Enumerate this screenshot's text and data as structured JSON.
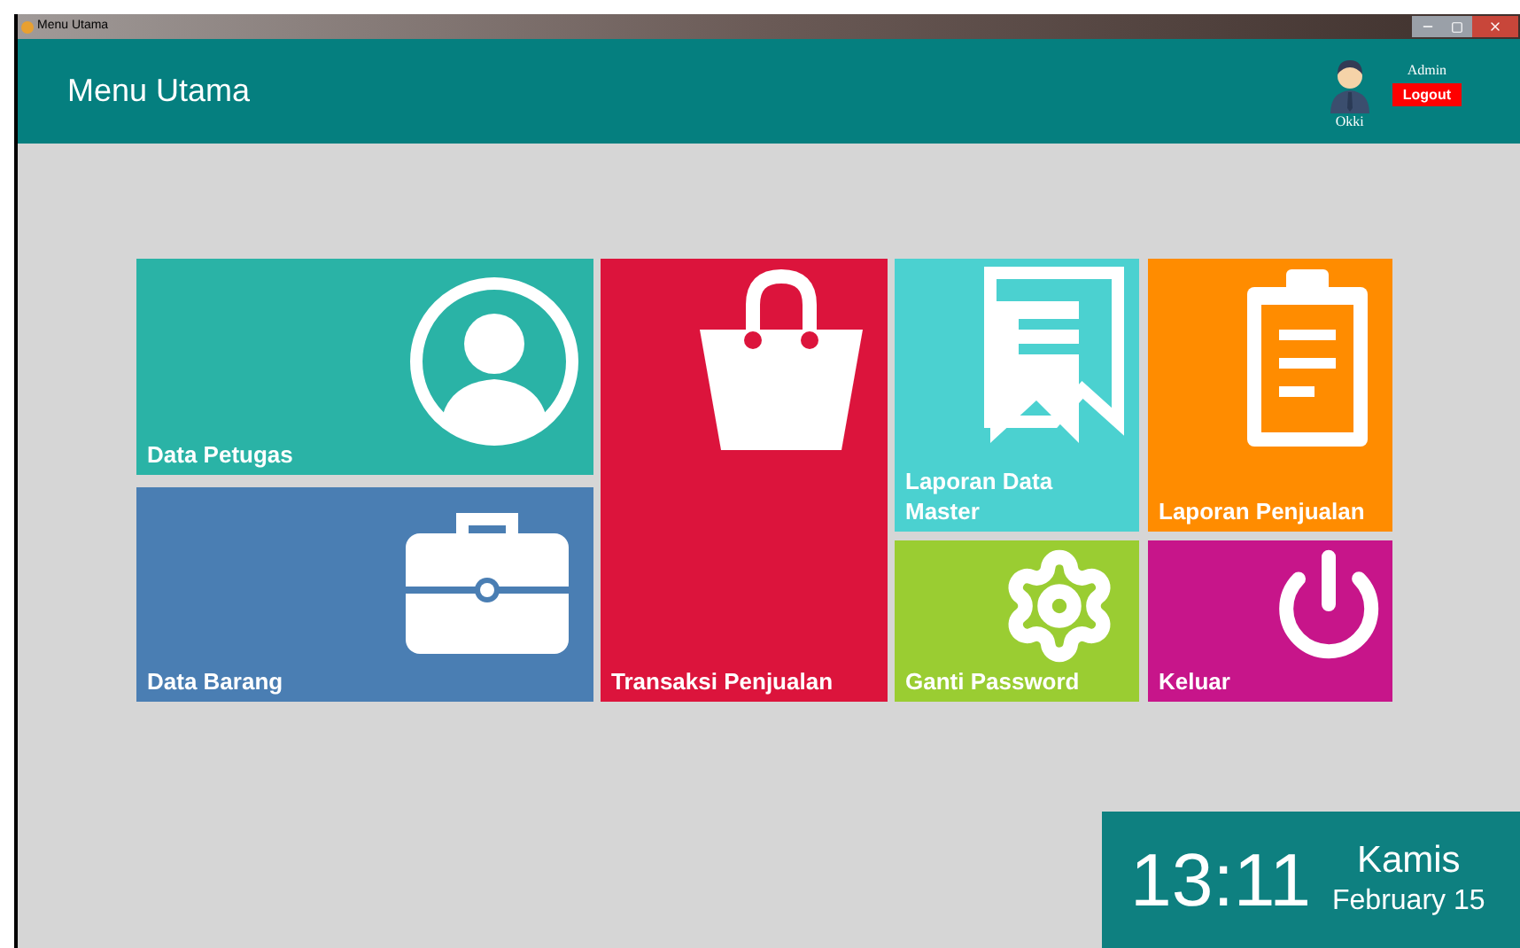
{
  "window": {
    "title": "Menu Utama"
  },
  "header": {
    "title": "Menu Utama",
    "user_name": "Okki",
    "role": "Admin",
    "logout": "Logout"
  },
  "tiles": [
    {
      "label": "Data Petugas",
      "kind": "person",
      "color": "#2ab3a6"
    },
    {
      "label": "Data Barang",
      "kind": "briefcase",
      "color": "#4a7eb3"
    },
    {
      "label": "Transaksi Penjualan",
      "kind": "bag",
      "color": "#dc143c"
    },
    {
      "label": "Laporan Data Master",
      "kind": "document",
      "color": "#4bd1d0"
    },
    {
      "label": "Laporan Penjualan",
      "kind": "clipboard",
      "color": "#ff8c00"
    },
    {
      "label": "Ganti Password",
      "kind": "gear",
      "color": "#9acd32"
    },
    {
      "label": "Keluar",
      "kind": "power",
      "color": "#c7158a"
    }
  ],
  "clock": {
    "time": "13:11",
    "day": "Kamis",
    "date": "February 15"
  }
}
